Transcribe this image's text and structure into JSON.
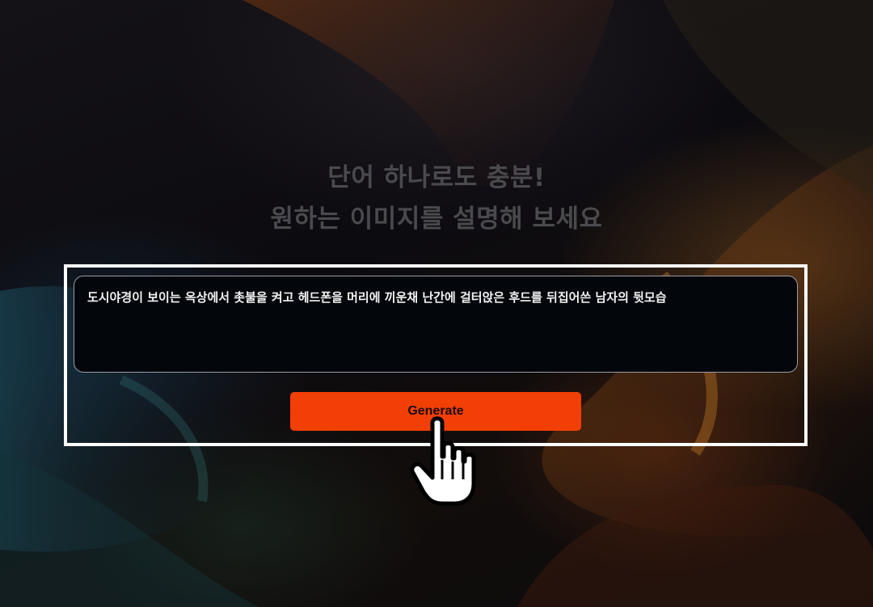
{
  "headline": {
    "line1": "단어 하나로도 충분!",
    "line2": "원하는 이미지를 설명해 보세요"
  },
  "prompt": {
    "value": "도시야경이 보이는 옥상에서 촛불을 켜고 헤드폰을 머리에 끼운채 난간에 걸터앉은 후드를 뒤집어쓴 남자의 뒷모습"
  },
  "actions": {
    "generate_label": "Generate"
  },
  "colors": {
    "button": "#f23f05",
    "panel_border": "#ffffff",
    "headline": "#4a4a4d"
  },
  "icons": {
    "cursor": "pointing-hand-cursor-icon"
  }
}
